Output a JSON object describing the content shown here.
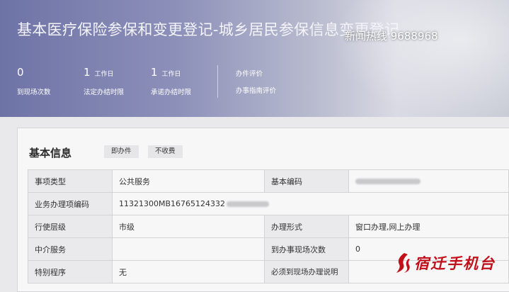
{
  "header": {
    "title": "基本医疗保险参保和变更登记-城乡居民参保信息变更登记",
    "stats": [
      {
        "value": "0",
        "unit": "",
        "label": "到现场次数"
      },
      {
        "value": "1",
        "unit": "工作日",
        "label": "法定办结时限"
      },
      {
        "value": "1",
        "unit": "工作日",
        "label": "承诺办结时限"
      }
    ],
    "links": [
      "办件评价",
      "办事指南评价"
    ]
  },
  "overlay": {
    "hotline": "新闻热线  9688968",
    "logo_text": "宿迁手机台"
  },
  "basic_info": {
    "title": "基本信息",
    "tags": [
      "即办件",
      "不收费"
    ],
    "rows": [
      {
        "k1": "事项类型",
        "v1": "公共服务",
        "k2": "基本编码",
        "v2": ""
      },
      {
        "k1": "业务办理项编码",
        "v1": "11321300MB16765124332"
      },
      {
        "k1": "行使层级",
        "v1": "市级",
        "k2": "办理形式",
        "v2": "窗口办理,网上办理"
      },
      {
        "k1": "中介服务",
        "v1": "",
        "k2": "到办事现场次数",
        "v2": "0"
      },
      {
        "k1": "特别程序",
        "v1": "无",
        "k2": "必须到现场办理说明",
        "v2": ""
      }
    ]
  },
  "colors": {
    "banner": "#7a7fae",
    "logo_red": "#c2101a"
  }
}
